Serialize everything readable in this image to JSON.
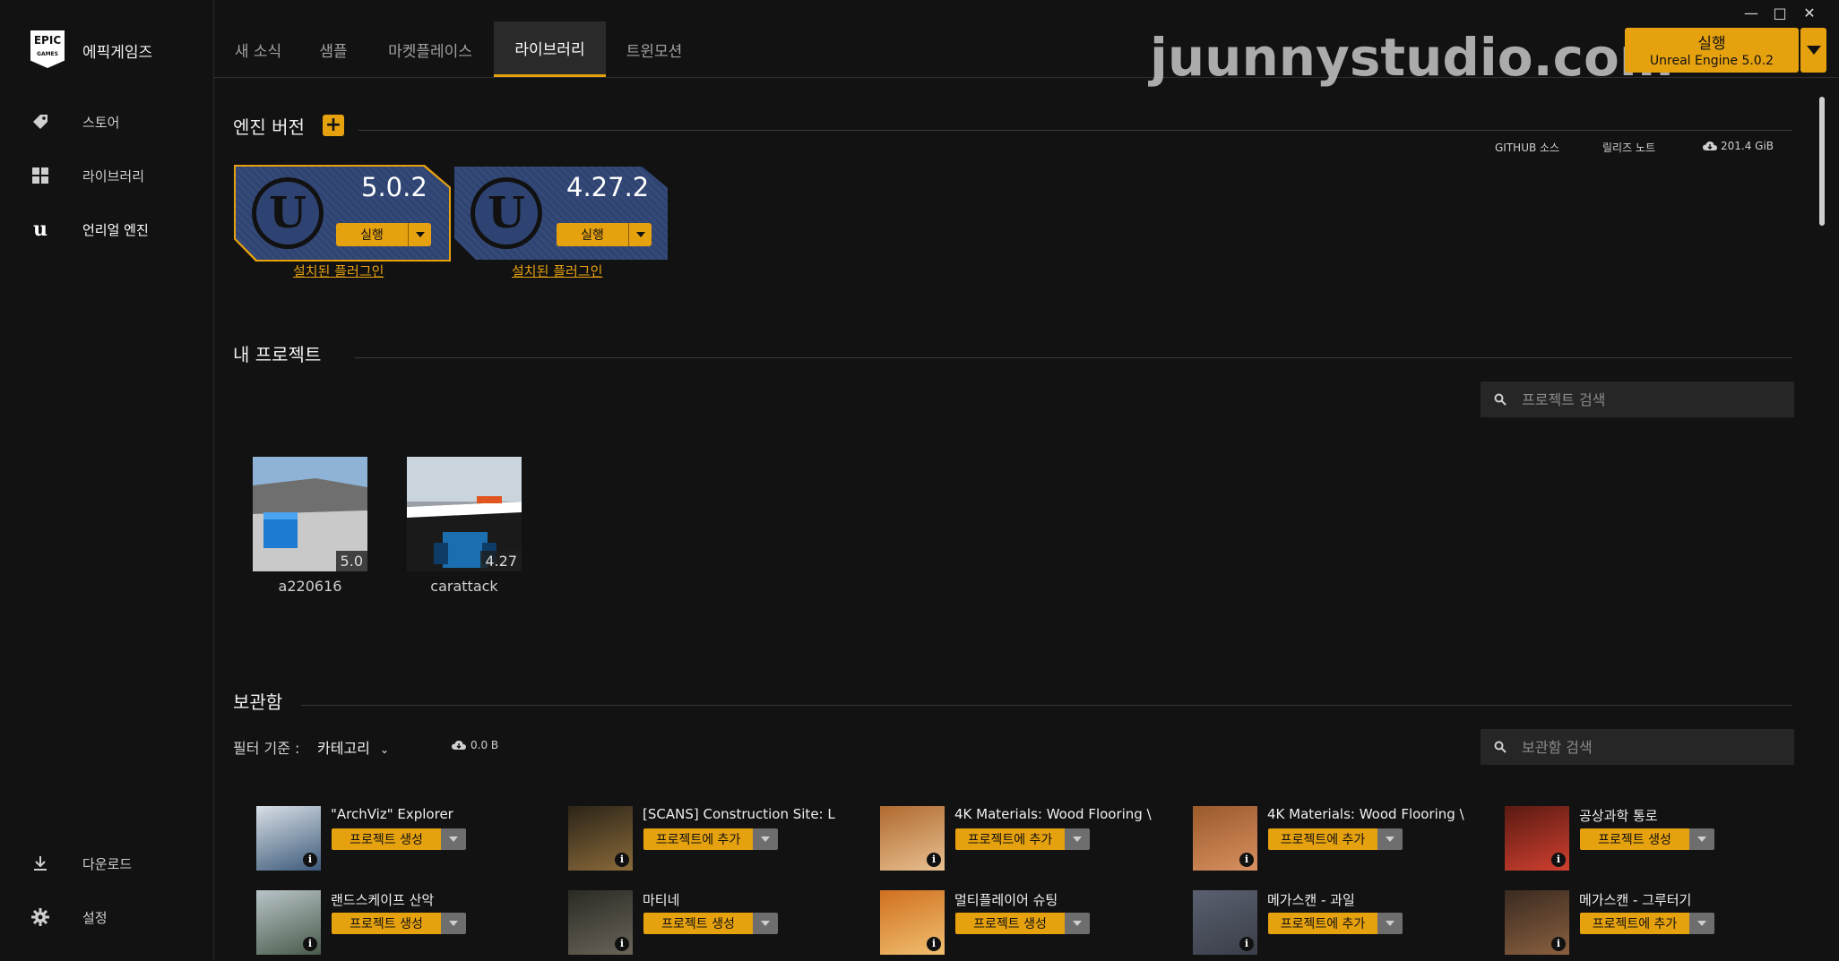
{
  "sidebar": {
    "logo_text": "EPIC\nGAMES",
    "brand": "에픽게임즈",
    "items": [
      {
        "label": "스토어",
        "icon": "tag-icon"
      },
      {
        "label": "라이브러리",
        "icon": "grid-icon"
      },
      {
        "label": "언리얼 엔진",
        "icon": "unreal-icon"
      }
    ],
    "bottom": [
      {
        "label": "다운로드",
        "icon": "download-icon"
      },
      {
        "label": "설정",
        "icon": "gear-icon"
      }
    ]
  },
  "tabs": [
    "새 소식",
    "샘플",
    "마켓플레이스",
    "라이브러리",
    "트윈모션"
  ],
  "active_tab": "라이브러리",
  "watermark": "juunnystudio.com",
  "launch": {
    "label": "실행",
    "sub": "Unreal Engine 5.0.2"
  },
  "engine_section": {
    "title": "엔진 버전",
    "links": {
      "github": "GITHUB 소스",
      "release": "릴리즈 노트",
      "size": "201.4 GiB"
    },
    "versions": [
      {
        "version": "5.0.2",
        "run": "실행",
        "plugins": "설치된 플러그인",
        "selected": true
      },
      {
        "version": "4.27.2",
        "run": "실행",
        "plugins": "설치된 플러그인",
        "selected": false
      }
    ]
  },
  "projects": {
    "title": "내 프로젝트",
    "search_placeholder": "프로젝트 검색",
    "items": [
      {
        "name": "a220616",
        "version": "5.0"
      },
      {
        "name": "carattack",
        "version": "4.27"
      }
    ]
  },
  "vault": {
    "title": "보관함",
    "filter_label": "필터 기준 :",
    "filter_value": "카테고리",
    "size": "0.0 B",
    "search_placeholder": "보관함 검색",
    "items": [
      {
        "title": "\"ArchViz\" Explorer",
        "action": "프로젝트 생성"
      },
      {
        "title": "[SCANS] Construction Site: L",
        "action": "프로젝트에 추가"
      },
      {
        "title": "4K Materials: Wood Flooring \\",
        "action": "프로젝트에 추가"
      },
      {
        "title": "4K Materials: Wood Flooring \\",
        "action": "프로젝트에 추가"
      },
      {
        "title": "공상과학 통로",
        "action": "프로젝트 생성"
      },
      {
        "title": "랜드스케이프 산악",
        "action": "프로젝트 생성"
      },
      {
        "title": "마티네",
        "action": "프로젝트 생성"
      },
      {
        "title": "멀티플레이어 슈팅",
        "action": "프로젝트 생성"
      },
      {
        "title": "메가스캔 - 과일",
        "action": "프로젝트에 추가"
      },
      {
        "title": "메가스캔 - 그루터기",
        "action": "프로젝트에 추가"
      }
    ]
  },
  "colors": {
    "accent": "#e6a10f",
    "background": "#121212",
    "engine_card": "#2e4372"
  }
}
